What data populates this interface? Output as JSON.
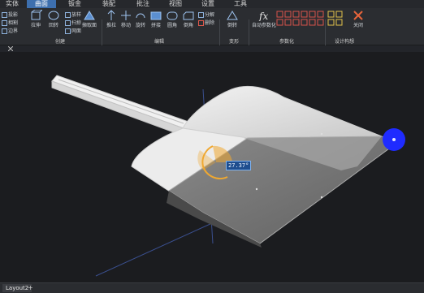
{
  "tabs": [
    {
      "label": "实体",
      "active": false
    },
    {
      "label": "曲面",
      "active": true
    },
    {
      "label": "钣金",
      "active": false
    },
    {
      "label": "装配",
      "active": false
    },
    {
      "label": "批注",
      "active": false
    },
    {
      "label": "视图",
      "active": false
    },
    {
      "label": "设置",
      "active": false
    },
    {
      "label": "工具",
      "active": false
    }
  ],
  "ribbon": {
    "small_left": [
      "投影",
      "相割",
      "边界"
    ],
    "create": {
      "extrude": "拉伸",
      "revolve": "回转",
      "loft": "放样",
      "sweep": "扫掠",
      "mesh": "网面",
      "extract": "撷取面"
    },
    "edit": {
      "pull": "推拉",
      "move": "移动",
      "rotate": "旋转",
      "stitch": "拼接",
      "fillet": "圆角",
      "chamfer": "倒角",
      "explode": "分解",
      "delete": "删除"
    },
    "transform": {
      "mirror": "倒转"
    },
    "param": {
      "auto": "自动参数化"
    },
    "design": {
      "close": "关闭"
    },
    "groups": {
      "create": "创建",
      "edit": "编辑",
      "transform": "变形",
      "param": "参数化",
      "design": "设计构想"
    }
  },
  "viewport": {
    "angle_readout": "27.37°",
    "handle_color": "#1f2bff",
    "arc_color": "#f0a830"
  },
  "bottom": {
    "layout_tab": "Layout2",
    "add": "+"
  }
}
